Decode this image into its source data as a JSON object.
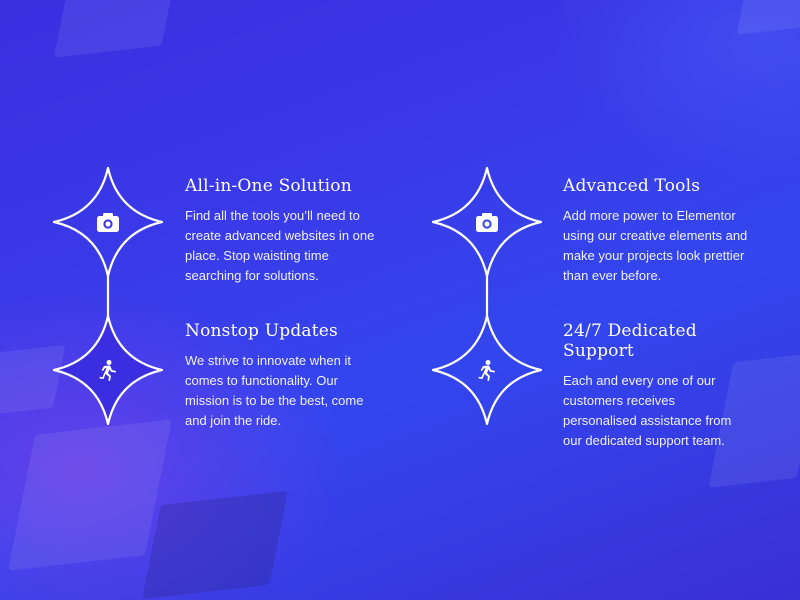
{
  "features": [
    {
      "title": "All-in-One Solution",
      "description": "Find all the tools you’ll need to create advanced websites in one place. Stop waisting time searching for solutions.",
      "icon": "camera-icon"
    },
    {
      "title": "Nonstop Updates",
      "description": "We strive to innovate when it comes to functionality. Our mission is to be the best, come and join the ride.",
      "icon": "running-person-icon"
    },
    {
      "title": "Advanced Tools",
      "description": "Add more power to Elementor using our creative elements and make your projects look prettier than ever before.",
      "icon": "camera-icon"
    },
    {
      "title": "24/7 Dedicated Support",
      "description": "Each and every one of our customers receives personalised assistance from our dedicated support team.",
      "icon": "running-person-icon"
    }
  ],
  "colors": {
    "background_start": "#3b2fe0",
    "background_end": "#3346ee",
    "star_fill_active": "#3a2ee0",
    "stroke": "#ffffff"
  }
}
